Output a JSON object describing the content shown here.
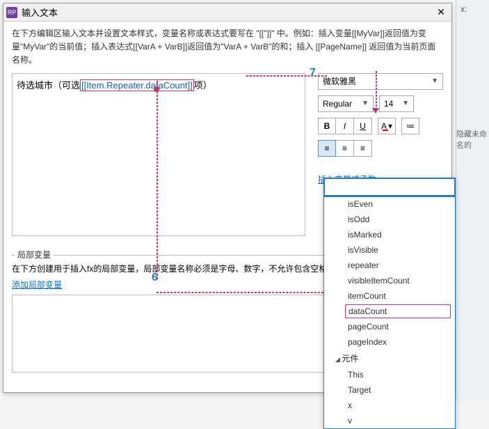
{
  "dialog": {
    "title": "输入文本",
    "help": "在下方编辑区输入文本并设置文本样式，变量名称或表达式要写在 \"[[\"]]\" 中。例如：插入变量[[MyVar]]返回值为变量\"MyVar\"的当前值；插入表达式[[VarA + VarB]]返回值为\"VarA + VarB\"的和；插入 [[PageName]] 返回值为当前页面名称。"
  },
  "editor": {
    "prefix": "待选城市（可选",
    "token": "[[Item.Repeater.dataCount]]",
    "suffix": "项）"
  },
  "toolbar": {
    "font": "微软雅黑",
    "weight": "Regular",
    "size": "14",
    "bold": "B",
    "italic": "I",
    "underline": "U",
    "color": "A",
    "bullet": "≔",
    "align_left": "≡",
    "align_center": "≡",
    "align_right": "≡",
    "insert_link": "插入变量或函数..."
  },
  "local": {
    "section_label": "局部变量",
    "desc": "在下方创建用于插入fx的局部变量，局部变量名称必须是字母、数字，不允许包含空格。",
    "add_link": "添加局部变量"
  },
  "dropdown": {
    "items": [
      {
        "label": "isEven",
        "type": "item"
      },
      {
        "label": "isOdd",
        "type": "item"
      },
      {
        "label": "isMarked",
        "type": "item"
      },
      {
        "label": "isVisible",
        "type": "item"
      },
      {
        "label": "repeater",
        "type": "item"
      },
      {
        "label": "visibleItemCount",
        "type": "item"
      },
      {
        "label": "itemCount",
        "type": "item"
      },
      {
        "label": "dataCount",
        "type": "highlight"
      },
      {
        "label": "pageCount",
        "type": "item"
      },
      {
        "label": "pageIndex",
        "type": "item"
      },
      {
        "label": "元件",
        "type": "group"
      },
      {
        "label": "This",
        "type": "item"
      },
      {
        "label": "Target",
        "type": "item"
      },
      {
        "label": "x",
        "type": "item"
      },
      {
        "label": "v",
        "type": "item"
      }
    ]
  },
  "sidepanel": {
    "x_label": "x:",
    "hidden_text": "隐藏未命名的"
  },
  "annotations": {
    "num6": "6",
    "num7": "7"
  }
}
